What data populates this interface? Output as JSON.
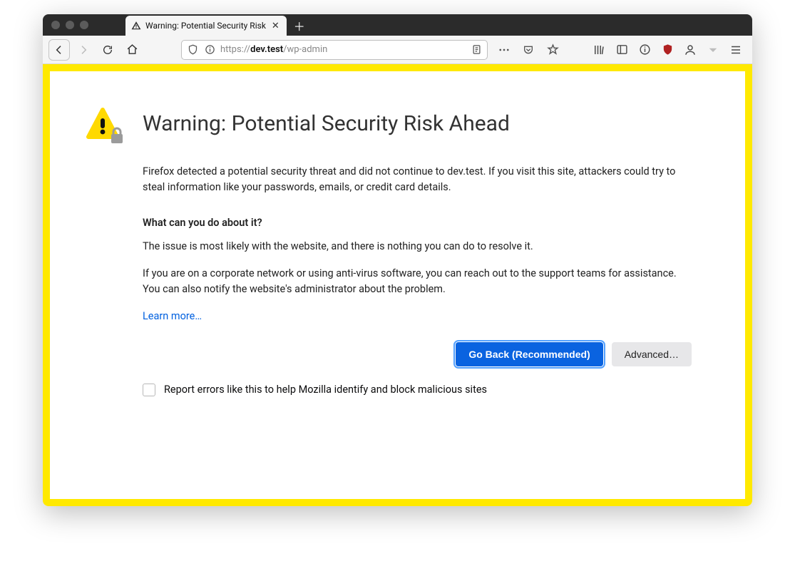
{
  "tab": {
    "title": "Warning: Potential Security Risk"
  },
  "url": {
    "protocol": "https://",
    "host_bold": "dev.test",
    "path": "/wp-admin"
  },
  "page": {
    "heading": "Warning: Potential Security Risk Ahead",
    "paragraph1": "Firefox detected a potential security threat and did not continue to dev.test. If you visit this site, attackers could try to steal information like your passwords, emails, or credit card details.",
    "subhead": "What can you do about it?",
    "paragraph2": "The issue is most likely with the website, and there is nothing you can do to resolve it.",
    "paragraph3": "If you are on a corporate network or using anti-virus software, you can reach out to the support teams for assistance. You can also notify the website's administrator about the problem.",
    "learn_more": "Learn more…",
    "go_back": "Go Back (Recommended)",
    "advanced": "Advanced…",
    "report_label": "Report errors like this to help Mozilla identify and block malicious sites"
  }
}
